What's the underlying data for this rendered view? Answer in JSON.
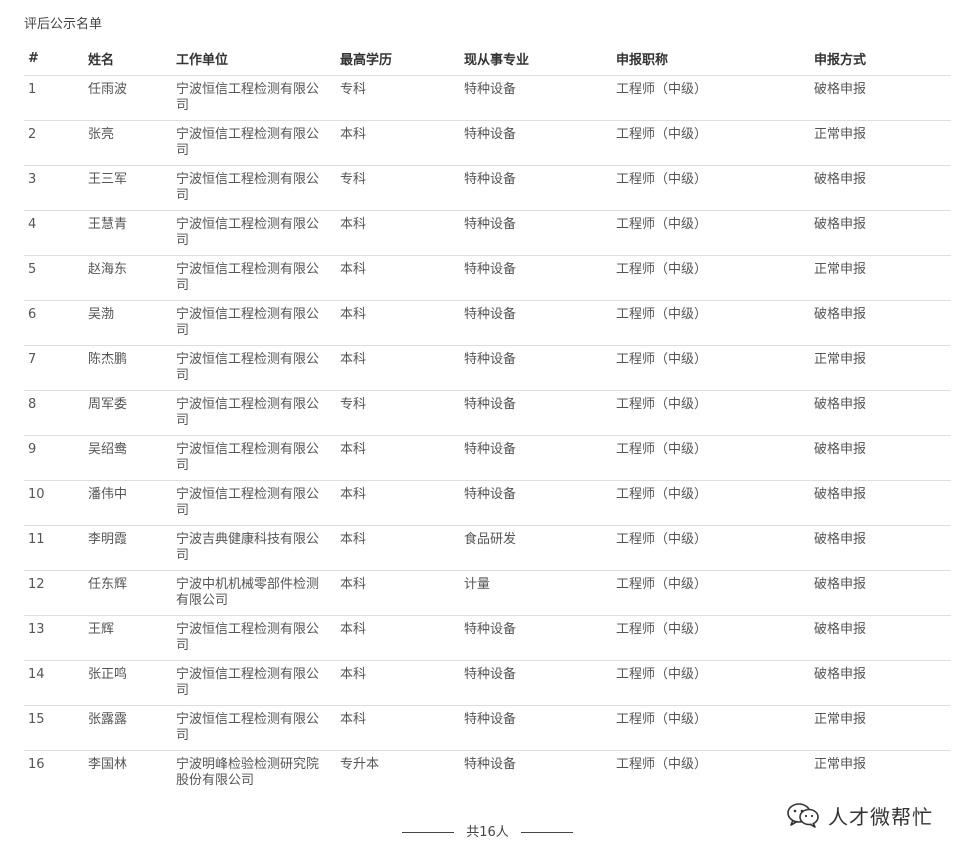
{
  "title": "评后公示名单",
  "columns": [
    "#",
    "姓名",
    "工作单位",
    "最高学历",
    "现从事专业",
    "申报职称",
    "申报方式"
  ],
  "rows": [
    [
      "1",
      "任雨波",
      "宁波恒信工程检测有限公司",
      "专科",
      "特种设备",
      "工程师（中级）",
      "破格申报"
    ],
    [
      "2",
      "张亮",
      "宁波恒信工程检测有限公司",
      "本科",
      "特种设备",
      "工程师（中级）",
      "正常申报"
    ],
    [
      "3",
      "王三军",
      "宁波恒信工程检测有限公司",
      "专科",
      "特种设备",
      "工程师（中级）",
      "破格申报"
    ],
    [
      "4",
      "王慧青",
      "宁波恒信工程检测有限公司",
      "本科",
      "特种设备",
      "工程师（中级）",
      "破格申报"
    ],
    [
      "5",
      "赵海东",
      "宁波恒信工程检测有限公司",
      "本科",
      "特种设备",
      "工程师（中级）",
      "正常申报"
    ],
    [
      "6",
      "吴渤",
      "宁波恒信工程检测有限公司",
      "本科",
      "特种设备",
      "工程师（中级）",
      "破格申报"
    ],
    [
      "7",
      "陈杰鹏",
      "宁波恒信工程检测有限公司",
      "本科",
      "特种设备",
      "工程师（中级）",
      "正常申报"
    ],
    [
      "8",
      "周军委",
      "宁波恒信工程检测有限公司",
      "专科",
      "特种设备",
      "工程师（中级）",
      "破格申报"
    ],
    [
      "9",
      "吴绍鸯",
      "宁波恒信工程检测有限公司",
      "本科",
      "特种设备",
      "工程师（中级）",
      "破格申报"
    ],
    [
      "10",
      "潘伟中",
      "宁波恒信工程检测有限公司",
      "本科",
      "特种设备",
      "工程师（中级）",
      "破格申报"
    ],
    [
      "11",
      "李明霞",
      "宁波吉典健康科技有限公司",
      "本科",
      "食品研发",
      "工程师（中级）",
      "破格申报"
    ],
    [
      "12",
      "任东辉",
      "宁波中机机械零部件检测有限公司",
      "本科",
      "计量",
      "工程师（中级）",
      "破格申报"
    ],
    [
      "13",
      "王辉",
      "宁波恒信工程检测有限公司",
      "本科",
      "特种设备",
      "工程师（中级）",
      "破格申报"
    ],
    [
      "14",
      "张正鸣",
      "宁波恒信工程检测有限公司",
      "本科",
      "特种设备",
      "工程师（中级）",
      "破格申报"
    ],
    [
      "15",
      "张露露",
      "宁波恒信工程检测有限公司",
      "本科",
      "特种设备",
      "工程师（中级）",
      "正常申报"
    ],
    [
      "16",
      "李国林",
      "宁波明峰检验检测研究院股份有限公司",
      "专升本",
      "特种设备",
      "工程师（中级）",
      "正常申报"
    ]
  ],
  "footer": {
    "total": "共16人"
  },
  "watermark": {
    "label": "人才微帮忙",
    "icon": "wechat-icon"
  }
}
